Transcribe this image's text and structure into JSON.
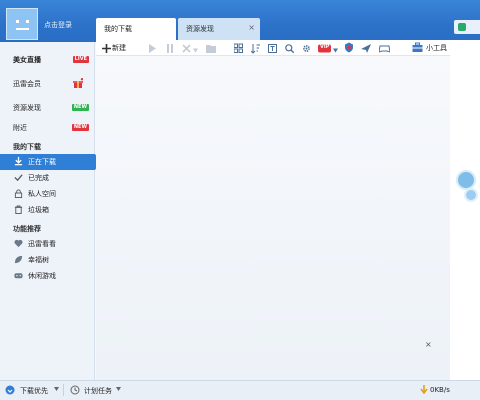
{
  "header": {
    "login_label": "点击登录",
    "tabs": [
      {
        "label": "我的下载",
        "active": true
      },
      {
        "label": "资源发现",
        "active": false,
        "close": "×"
      }
    ]
  },
  "sidebar": {
    "featured": [
      {
        "label": "美女直播",
        "badge": "LIVE",
        "badge_color": "#e2343d"
      },
      {
        "label": "迅雷会员",
        "badge_icon": "gift-icon",
        "badge_color": "#e2343d"
      },
      {
        "label": "资源发现",
        "badge": "NEW",
        "badge_color": "#2eb34f"
      },
      {
        "label": "附近",
        "badge": "NEW",
        "badge_color": "#e2343d"
      }
    ],
    "downloads_header": "我的下载",
    "downloads": [
      {
        "label": "正在下载",
        "icon": "download-icon",
        "selected": true
      },
      {
        "label": "已完成",
        "icon": "check-icon"
      },
      {
        "label": "私人空间",
        "icon": "lock-icon"
      },
      {
        "label": "垃圾箱",
        "icon": "trash-icon"
      }
    ],
    "recommend_header": "功能推荐",
    "recommend": [
      {
        "label": "迅雷看看",
        "icon": "heart-icon"
      },
      {
        "label": "幸福树",
        "icon": "leaf-icon"
      },
      {
        "label": "休闲游戏",
        "icon": "gamepad-icon"
      }
    ]
  },
  "toolbar": {
    "new_label": "新建",
    "tools_label": "小工具",
    "vip_label": "VIP"
  },
  "content": {
    "close": "×"
  },
  "statusbar": {
    "priority_label": "下载优先",
    "schedule_label": "计划任务",
    "speed": "0KB/s"
  },
  "colors": {
    "accent": "#2f7fd6",
    "title_bar": "#2c72c9",
    "live_red": "#e2343d",
    "new_green": "#2eb34f"
  }
}
